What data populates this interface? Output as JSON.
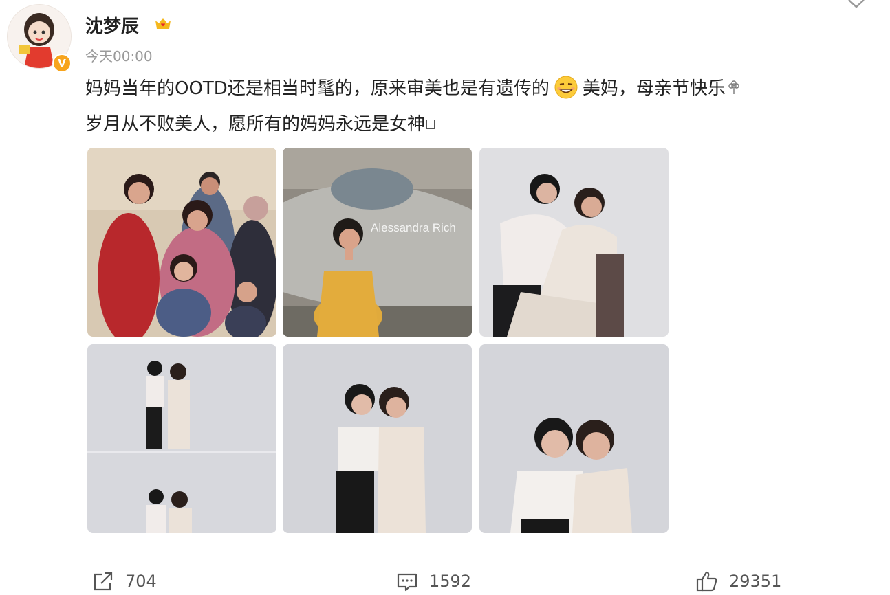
{
  "post": {
    "author": {
      "name": "沈梦辰",
      "verified_badge": "V",
      "crown_icon": "crown-heart-icon"
    },
    "timestamp": "今天00:00",
    "text": {
      "line1_a": "妈妈当年的OOTD还是相当时髦的，原来审美也是有遗传的",
      "line1_b": "美妈，母亲节快乐",
      "line2": "岁月从不败美人，愿所有的妈妈永远是女神"
    },
    "photos": [
      {
        "watermark": ""
      },
      {
        "watermark": "Alessandra Rich"
      },
      {
        "watermark": ""
      },
      {
        "watermark": ""
      },
      {
        "watermark": ""
      },
      {
        "watermark": ""
      }
    ],
    "stats": {
      "shares": "704",
      "comments": "1592",
      "likes": "29351"
    }
  },
  "colors": {
    "badge": "#f7a41d",
    "text": "#222222",
    "meta": "#9a9a9a"
  }
}
